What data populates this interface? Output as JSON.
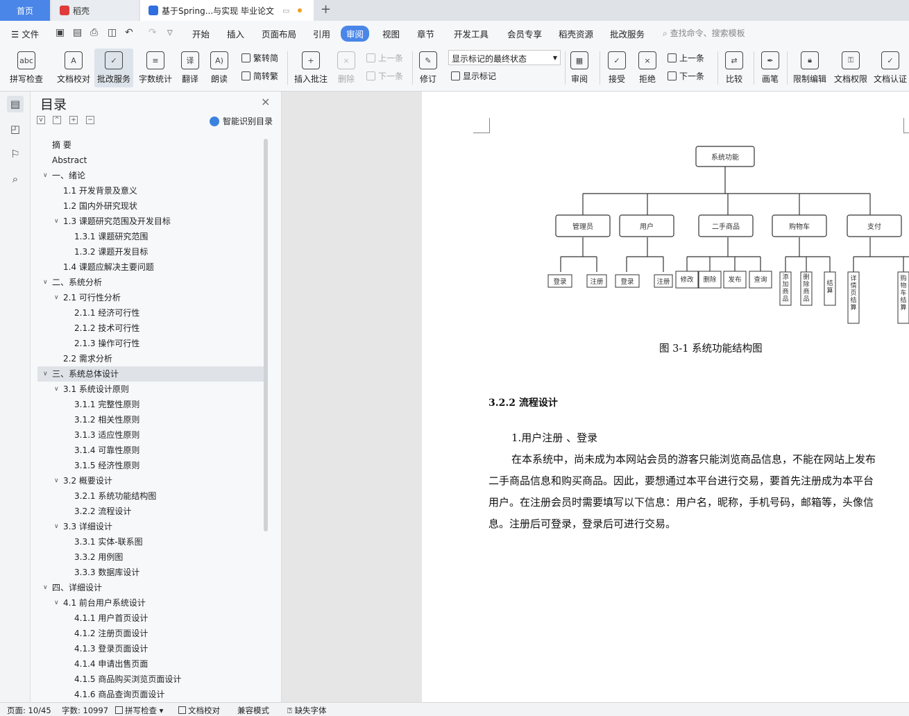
{
  "tabs": {
    "home": "首页",
    "daoke": "稻壳",
    "doc": "基于Spring...与实现 毕业论文"
  },
  "menu": {
    "file": "文件",
    "items": [
      "开始",
      "插入",
      "页面布局",
      "引用",
      "审阅",
      "视图",
      "章节",
      "开发工具",
      "会员专享",
      "稻壳资源",
      "批改服务"
    ],
    "active": "审阅",
    "search_placeholder": "查找命令、搜索模板"
  },
  "ribbon": {
    "spell": "拼写检查",
    "proof": "文档校对",
    "correct": "批改服务",
    "wordcount": "字数统计",
    "translate": "翻译",
    "read": "朗读",
    "to_trad": "繁转简",
    "to_simp": "简转繁",
    "insert_comment": "插入批注",
    "delete": "删除",
    "prev_comment": "上一条",
    "next_comment": "下一条",
    "revise": "修订",
    "markup_state": "显示标记的最终状态",
    "show_markup": "显示标记",
    "review": "审阅",
    "accept": "接受",
    "reject": "拒绝",
    "prev": "上一条",
    "next": "下一条",
    "compare": "比较",
    "pen": "画笔",
    "restrict": "限制编辑",
    "doc_perm": "文档权限",
    "doc_auth": "文档认证"
  },
  "toc": {
    "title": "目录",
    "smart": "智能识别目录",
    "items": [
      {
        "label": "摘    要",
        "level": 0,
        "caret": ""
      },
      {
        "label": "Abstract",
        "level": 0,
        "caret": ""
      },
      {
        "label": "一、绪论",
        "level": 0,
        "caret": "v"
      },
      {
        "label": "1.1 开发背景及意义",
        "level": 1,
        "caret": ""
      },
      {
        "label": "1.2  国内外研究现状",
        "level": 1,
        "caret": ""
      },
      {
        "label": "1.3  课题研究范围及开发目标",
        "level": 1,
        "caret": "v"
      },
      {
        "label": "1.3.1  课题研究范围",
        "level": 2,
        "caret": ""
      },
      {
        "label": "1.3.2  课题开发目标",
        "level": 2,
        "caret": ""
      },
      {
        "label": "1.4  课题应解决主要问题",
        "level": 1,
        "caret": ""
      },
      {
        "label": "二、系统分析",
        "level": 0,
        "caret": "v"
      },
      {
        "label": "2.1 可行性分析",
        "level": 1,
        "caret": "v"
      },
      {
        "label": "2.1.1  经济可行性",
        "level": 2,
        "caret": ""
      },
      {
        "label": "2.1.2    技术可行性",
        "level": 2,
        "caret": ""
      },
      {
        "label": "2.1.3  操作可行性",
        "level": 2,
        "caret": ""
      },
      {
        "label": "2.2 需求分析",
        "level": 1,
        "caret": ""
      },
      {
        "label": "三、系统总体设计",
        "level": 0,
        "caret": "v",
        "selected": true
      },
      {
        "label": "3.1 系统设计原则",
        "level": 1,
        "caret": "v"
      },
      {
        "label": "3.1.1 完整性原则",
        "level": 2,
        "caret": ""
      },
      {
        "label": "3.1.2 相关性原则",
        "level": 2,
        "caret": ""
      },
      {
        "label": "3.1.3  适应性原则",
        "level": 2,
        "caret": ""
      },
      {
        "label": "3.1.4 可靠性原则",
        "level": 2,
        "caret": ""
      },
      {
        "label": "3.1.5 经济性原则",
        "level": 2,
        "caret": ""
      },
      {
        "label": "3.2  概要设计",
        "level": 1,
        "caret": "v"
      },
      {
        "label": "3.2.1  系统功能结构图",
        "level": 2,
        "caret": ""
      },
      {
        "label": "3.2.2  流程设计",
        "level": 2,
        "caret": ""
      },
      {
        "label": "3.3  详细设计",
        "level": 1,
        "caret": "v"
      },
      {
        "label": "3.3.1  实体-联系图",
        "level": 2,
        "caret": ""
      },
      {
        "label": "3.3.2  用例图",
        "level": 2,
        "caret": ""
      },
      {
        "label": "3.3.3 数据库设计",
        "level": 2,
        "caret": ""
      },
      {
        "label": "四、详细设计",
        "level": 0,
        "caret": "v"
      },
      {
        "label": "4.1 前台用户系统设计",
        "level": 1,
        "caret": "v"
      },
      {
        "label": "4.1.1 用户首页设计",
        "level": 2,
        "caret": ""
      },
      {
        "label": "4.1.2 注册页面设计",
        "level": 2,
        "caret": ""
      },
      {
        "label": "4.1.3 登录页面设计",
        "level": 2,
        "caret": ""
      },
      {
        "label": "4.1.4 申请出售页面",
        "level": 2,
        "caret": ""
      },
      {
        "label": "4.1.5 商品购买浏览页面设计",
        "level": 2,
        "caret": ""
      },
      {
        "label": "4.1.6 商品查询页面设计",
        "level": 2,
        "caret": ""
      }
    ]
  },
  "diagram": {
    "root": "系统功能",
    "l1": [
      "管理员",
      "用户",
      "二手商品",
      "购物车",
      "支付"
    ],
    "admin": [
      "登录",
      "注册"
    ],
    "user": [
      "登录",
      "注册"
    ],
    "goods": [
      "修改",
      "删除",
      "发布",
      "查询"
    ],
    "cart": [
      "添加商品",
      "删除商品",
      "结算"
    ],
    "pay": [
      "详情页结算",
      "购物车结算"
    ],
    "caption": "图 3-1  系统功能结构图"
  },
  "doc": {
    "heading": "3.2.2  流程设计",
    "sub": "1.用户注册  、登录",
    "lines": [
      "在本系统中，尚未成为本网站会员的游客只能浏览商品信息，不能在网站上发布",
      "二手商品信息和购买商品。因此，要想通过本平台进行交易，要首先注册成为本平台",
      "用户。在注册会员时需要填写以下信息：用户名，昵称，手机号码，邮箱等，头像信",
      "息。注册后可登录，登录后可进行交易。"
    ]
  },
  "status": {
    "page": "页面: 10/45",
    "words": "字数: 10997",
    "spell": "拼写检查",
    "proof": "文档校对",
    "compat": "兼容模式",
    "missing_font": "缺失字体"
  }
}
